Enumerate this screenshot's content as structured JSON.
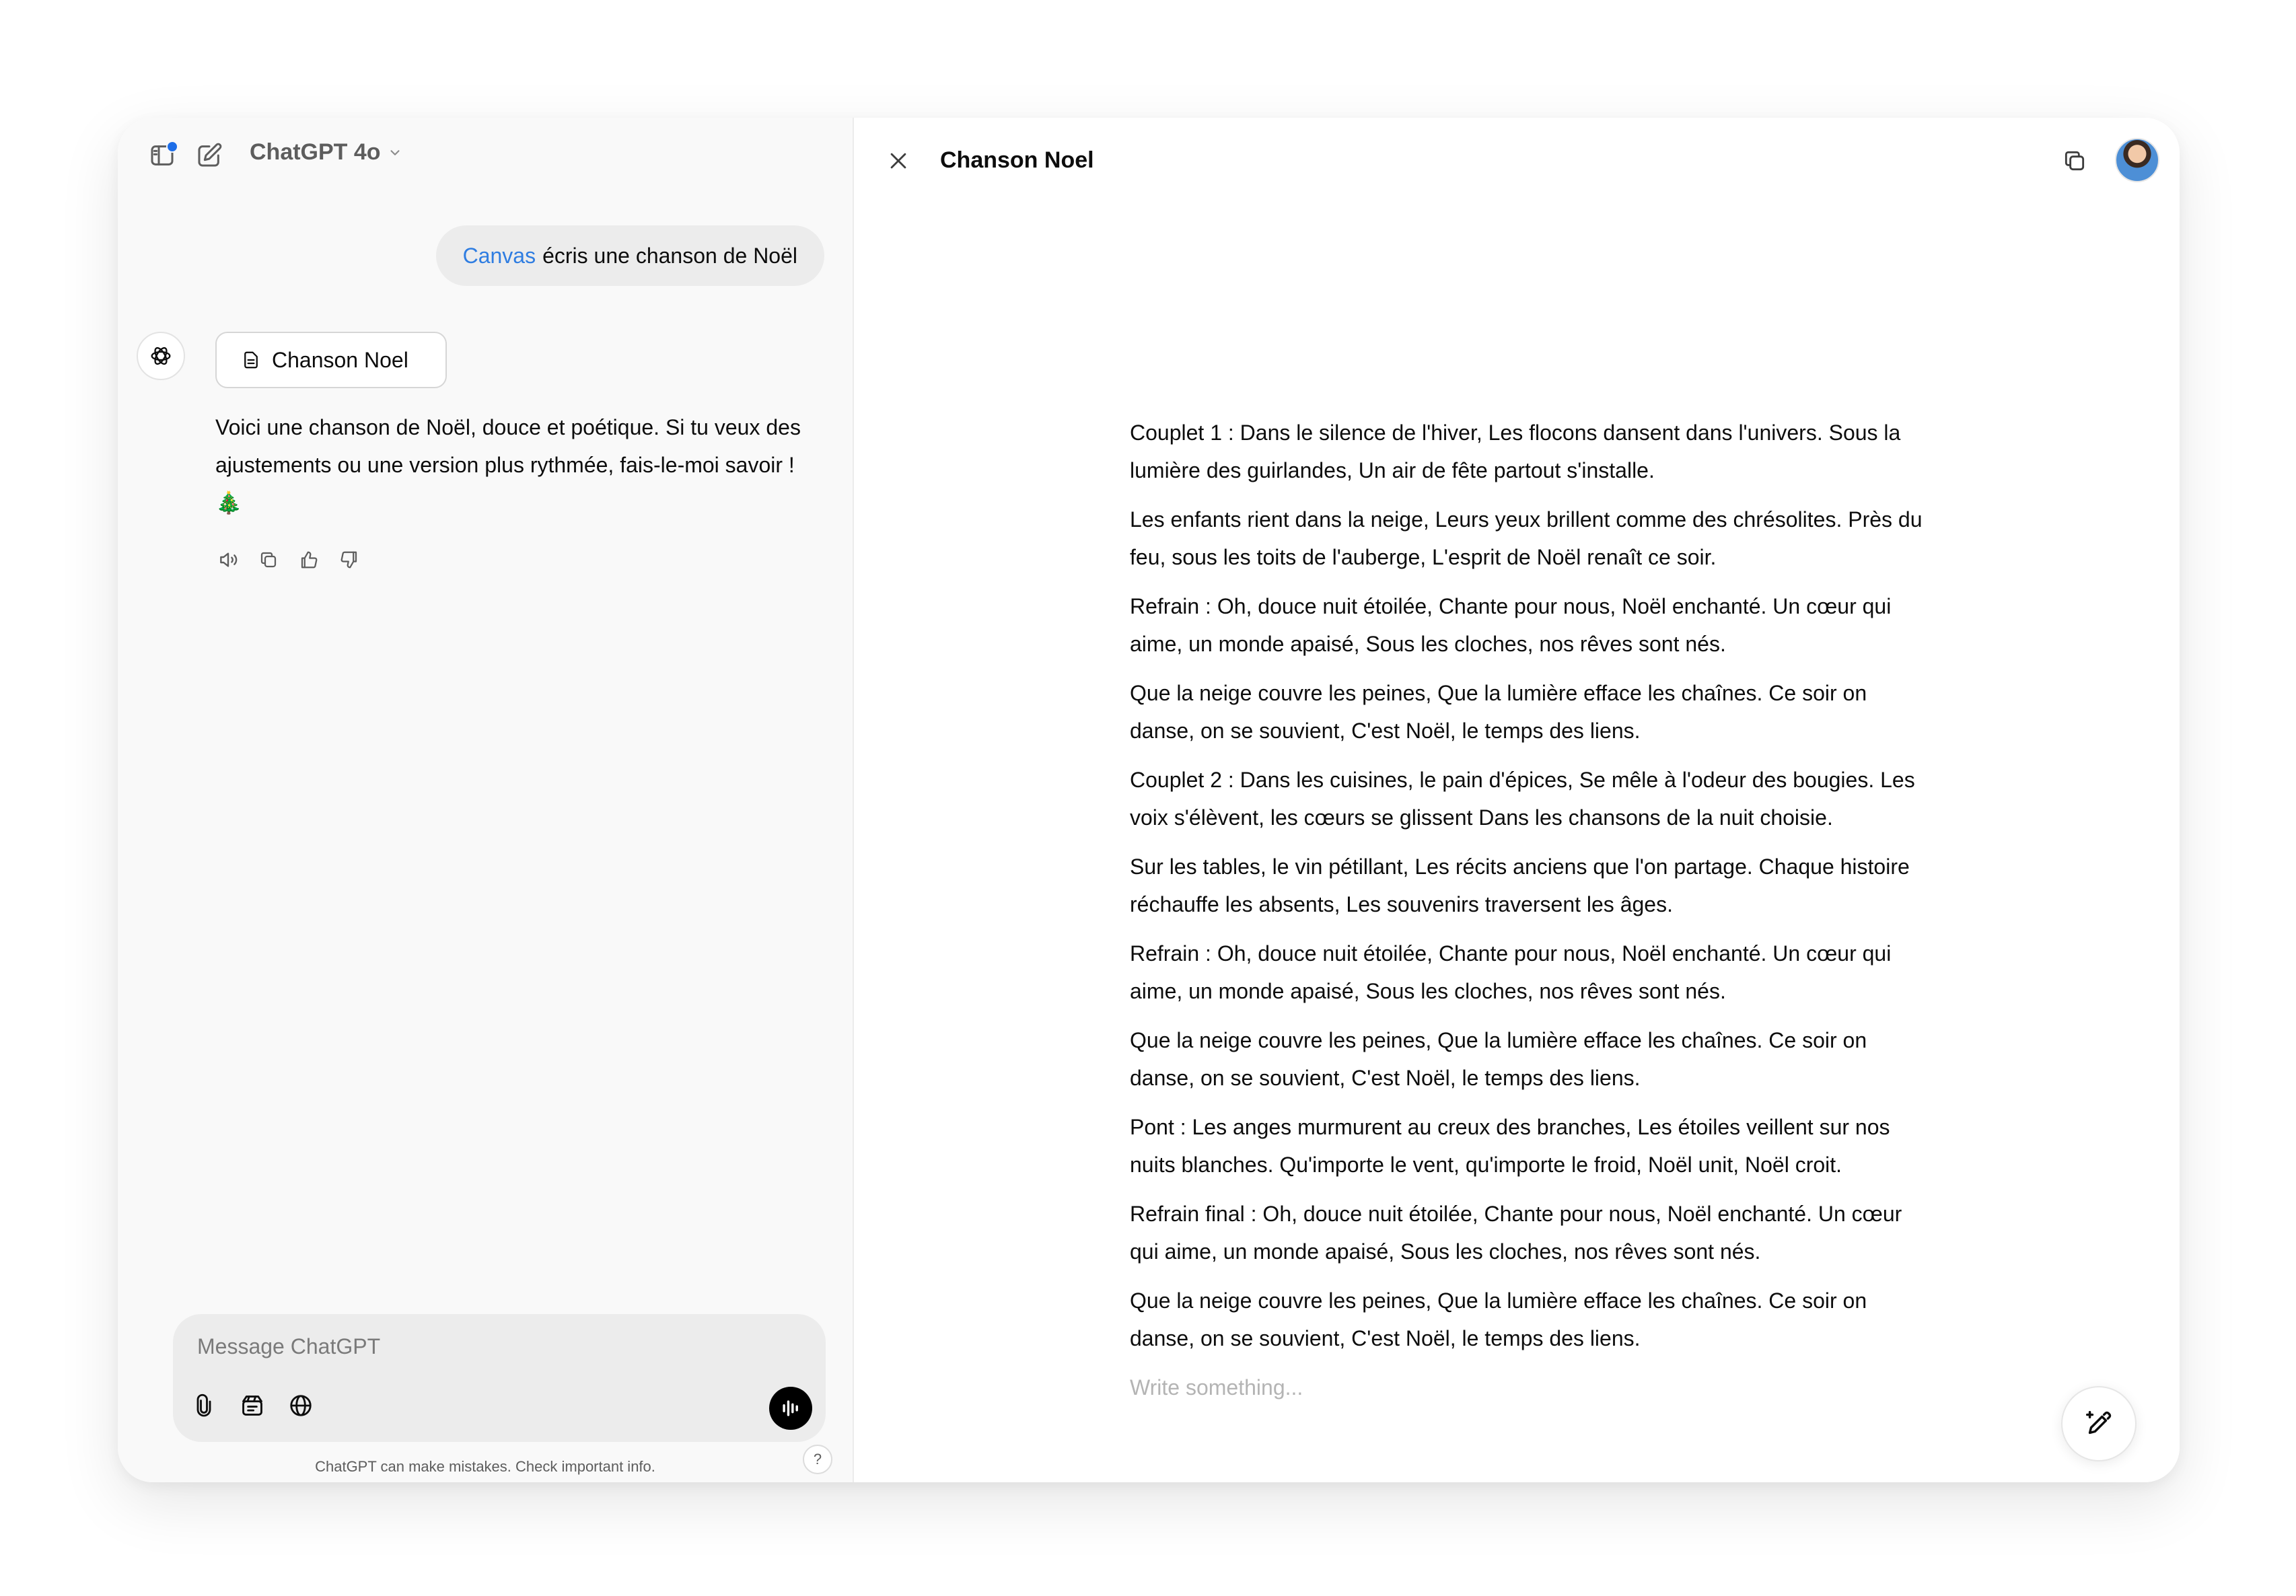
{
  "header": {
    "model_name": "ChatGPT 4o"
  },
  "conversation": {
    "user_message": {
      "tag": "Canvas",
      "text": "écris une chanson de Noël"
    },
    "assistant_message": {
      "doc_chip_label": "Chanson Noel",
      "text": "Voici une chanson de Noël, douce et poétique. Si tu veux des ajustements ou une version plus rythmée, fais-le-moi savoir ! 🎄"
    }
  },
  "composer": {
    "placeholder": "Message ChatGPT"
  },
  "footer": {
    "disclaimer": "ChatGPT can make mistakes. Check important info.",
    "help_label": "?"
  },
  "canvas": {
    "title": "Chanson Noel",
    "paragraphs": [
      "Couplet 1 : Dans le silence de l'hiver, Les flocons dansent dans l'univers. Sous la lumière des guirlandes, Un air de fête partout s'installe.",
      "Les enfants rient dans la neige, Leurs yeux brillent comme des chrésolites. Près du feu, sous les toits de l'auberge, L'esprit de Noël renaît ce soir.",
      "Refrain : Oh, douce nuit étoilée, Chante pour nous, Noël enchanté. Un cœur qui aime, un monde apaisé, Sous les cloches, nos rêves sont nés.",
      "Que la neige couvre les peines, Que la lumière efface les chaînes. Ce soir on danse, on se souvient, C'est Noël, le temps des liens.",
      "Couplet 2 : Dans les cuisines, le pain d'épices, Se mêle à l'odeur des bougies. Les voix s'élèvent, les cœurs se glissent Dans les chansons de la nuit choisie.",
      "Sur les tables, le vin pétillant, Les récits anciens que l'on partage. Chaque histoire réchauffe les absents, Les souvenirs traversent les âges.",
      "Refrain : Oh, douce nuit étoilée, Chante pour nous, Noël enchanté. Un cœur qui aime, un monde apaisé, Sous les cloches, nos rêves sont nés.",
      "Que la neige couvre les peines, Que la lumière efface les chaînes. Ce soir on danse, on se souvient, C'est Noël, le temps des liens.",
      "Pont : Les anges murmurent au creux des branches, Les étoiles veillent sur nos nuits blanches. Qu'importe le vent, qu'importe le froid, Noël unit, Noël croit.",
      "Refrain final : Oh, douce nuit étoilée, Chante pour nous, Noël enchanté. Un cœur qui aime, un monde apaisé, Sous les cloches, nos rêves sont nés.",
      "Que la neige couvre les peines, Que la lumière efface les chaînes. Ce soir on danse, on se souvient, C'est Noël, le temps des liens."
    ],
    "write_placeholder": "Write something..."
  },
  "icons": {
    "sidebar_toggle": "sidebar-toggle-icon",
    "new_chat": "new-chat-icon",
    "model_chevron": "chevron-down-icon",
    "assistant": "openai-logo-icon",
    "doc": "document-icon",
    "read_aloud": "speaker-icon",
    "copy": "copy-icon",
    "thumbs_up": "thumbs-up-icon",
    "thumbs_down": "thumbs-down-icon",
    "attach": "paperclip-icon",
    "tools": "tools-icon",
    "web": "globe-icon",
    "voice": "voice-waveform-icon",
    "close": "close-icon",
    "canvas_copy": "copy-icon",
    "edit": "edit-pencil-icon"
  },
  "colors": {
    "sidebar_bg": "#f9f9f9",
    "canvas_tag": "#2f7de1",
    "notification_dot": "#1e6ee8",
    "bubble_bg": "#ececec"
  }
}
